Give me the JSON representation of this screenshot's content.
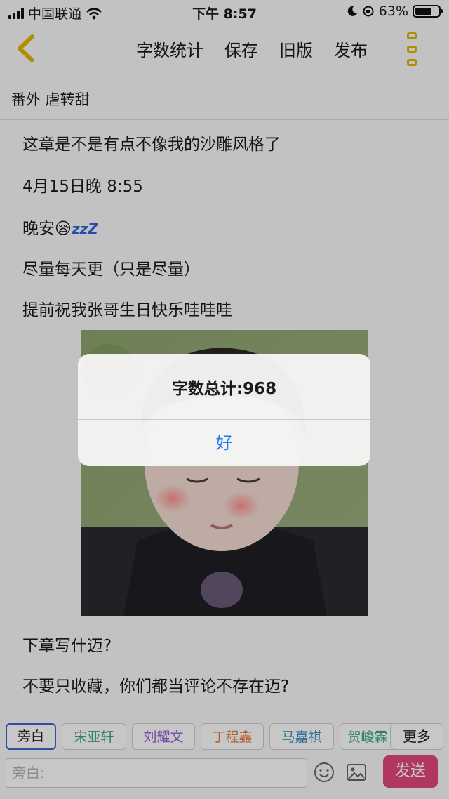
{
  "status_bar": {
    "carrier": "中国联通",
    "time": "下午 8:57",
    "battery": "63%"
  },
  "nav": {
    "word_count": "字数统计",
    "save": "保存",
    "old_version": "旧版",
    "publish": "发布"
  },
  "chapter_title": "番外 虐转甜",
  "paragraphs": [
    "这章是不是有点不像我的沙雕风格了",
    "4月15日晚 8:55",
    "晚安",
    "尽量每天更（只是尽量）",
    "提前祝我张哥生日快乐哇哇哇",
    "下章写什迈?",
    "不要只收藏，你们都当评论不存在迈?"
  ],
  "emoji": {
    "sleepy": "😪",
    "zzz": "zzZ"
  },
  "roles": [
    "旁白",
    "宋亚轩",
    "刘耀文",
    "丁程鑫",
    "马嘉祺",
    "贺峻霖"
  ],
  "role_colors": [
    "#222222",
    "#3aa58a",
    "#9a5fd0",
    "#e07a3d",
    "#3b8fc0",
    "#3aa58a"
  ],
  "more_label": "更多",
  "input": {
    "placeholder": "旁白:"
  },
  "send_label": "发送",
  "alert": {
    "message": "字数总计:968",
    "ok": "好"
  },
  "colors": {
    "accent_yellow": "#e0b800",
    "send_pink": "#e2487a",
    "link_blue": "#1f7cf0"
  }
}
